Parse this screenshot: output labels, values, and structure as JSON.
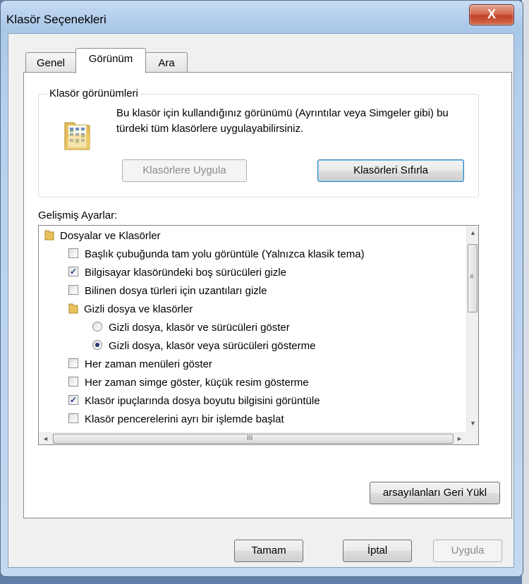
{
  "window": {
    "title": "Klasör Seçenekleri",
    "close_glyph": "X"
  },
  "tabs": [
    {
      "label": "Genel",
      "active": false
    },
    {
      "label": "Görünüm",
      "active": true
    },
    {
      "label": "Ara",
      "active": false
    }
  ],
  "folder_views": {
    "group_label": "Klasör görünümleri",
    "description": "Bu klasör için kullandığınız görünümü (Ayrıntılar veya Simgeler gibi) bu türdeki tüm klasörlere uygulayabilirsiniz.",
    "apply_button": "Klasörlere Uygula",
    "reset_button": "Klasörleri Sıfırla",
    "icon": "folder-view-icon"
  },
  "advanced": {
    "label": "Gelişmiş Ayarlar:",
    "items": [
      {
        "type": "folder",
        "text": "Dosyalar ve Klasörler"
      },
      {
        "type": "checkbox",
        "checked": false,
        "text": "Başlık çubuğunda tam yolu görüntüle (Yalnızca klasik tema)"
      },
      {
        "type": "checkbox",
        "checked": true,
        "text": "Bilgisayar klasöründeki boş sürücüleri gizle"
      },
      {
        "type": "checkbox",
        "checked": false,
        "text": "Bilinen dosya türleri için uzantıları gizle"
      },
      {
        "type": "folder",
        "text": "Gizli dosya ve klasörler"
      },
      {
        "type": "radio",
        "checked": false,
        "text": "Gizli dosya, klasör ve sürücüleri göster"
      },
      {
        "type": "radio",
        "checked": true,
        "text": "Gizli dosya, klasör veya sürücüleri gösterme"
      },
      {
        "type": "checkbox",
        "checked": false,
        "text": "Her zaman menüleri göster"
      },
      {
        "type": "checkbox",
        "checked": false,
        "text": "Her zaman simge göster, küçük resim gösterme"
      },
      {
        "type": "checkbox",
        "checked": true,
        "text": "Klasör ipuçlarında dosya boyutu bilgisini görüntüle"
      },
      {
        "type": "checkbox",
        "checked": false,
        "text": "Klasör pencerelerini ayrı bir işlemde başlat"
      }
    ],
    "restore_button": "arsayılanları Geri Yükl"
  },
  "footer": {
    "ok": "Tamam",
    "cancel": "İptal",
    "apply": "Uygula"
  },
  "scroll": {
    "up": "▲",
    "down": "▼",
    "left": "◄",
    "right": "►",
    "vgrip": "≡",
    "hgrip": "III"
  }
}
